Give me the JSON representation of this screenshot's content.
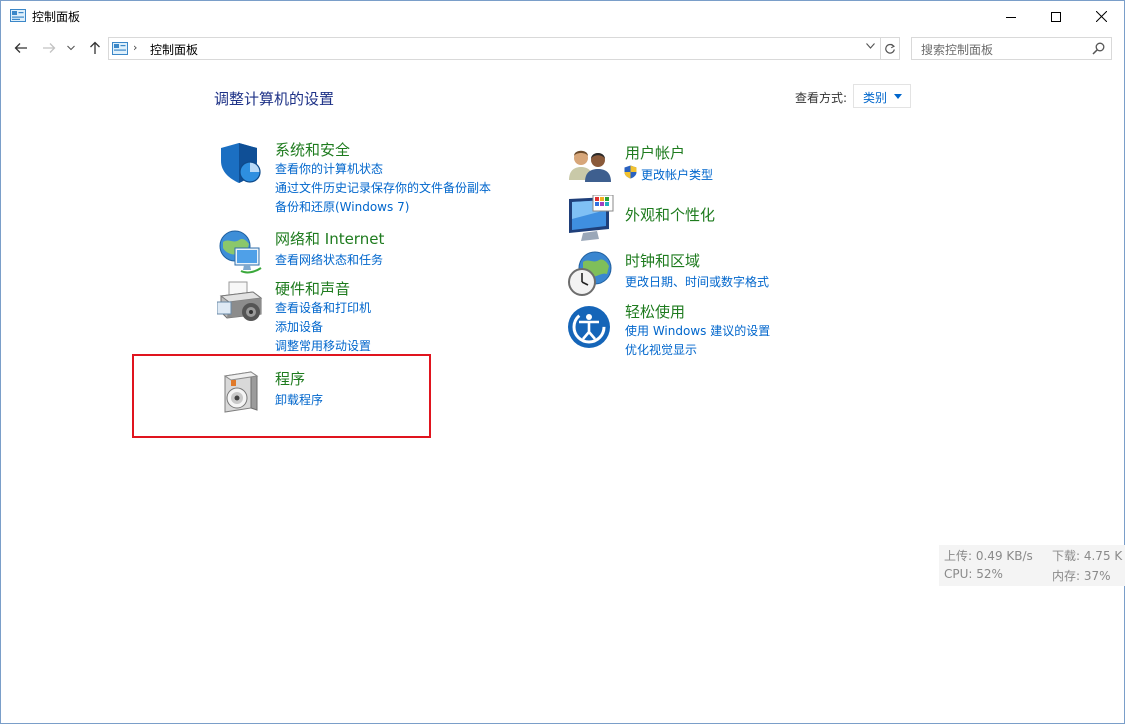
{
  "window": {
    "title": "控制面板",
    "icon": "control-panel-icon"
  },
  "nav": {
    "back_icon": "arrow-left-icon",
    "forward_icon": "arrow-right-icon",
    "recent_icon": "chevron-down-icon",
    "up_icon": "arrow-up-icon",
    "address_path": "控制面板",
    "search_placeholder": "搜索控制面板"
  },
  "main": {
    "heading": "调整计算机的设置",
    "view_by_label": "查看方式:",
    "view_by_value": "类别"
  },
  "categories": {
    "system_security": {
      "title": "系统和安全",
      "icon": "shield-icon",
      "links": [
        "查看你的计算机状态",
        "通过文件历史记录保存你的文件备份副本",
        "备份和还原(Windows 7)"
      ]
    },
    "network": {
      "title": "网络和 Internet",
      "icon": "network-globe-icon",
      "links": [
        "查看网络状态和任务"
      ]
    },
    "hardware": {
      "title": "硬件和声音",
      "icon": "printer-icon",
      "links": [
        "查看设备和打印机",
        "添加设备",
        "调整常用移动设置"
      ]
    },
    "programs": {
      "title": "程序",
      "icon": "programs-icon",
      "links": [
        "卸载程序"
      ]
    },
    "user_accounts": {
      "title": "用户帐户",
      "icon": "users-icon",
      "links": [
        "更改帐户类型"
      ]
    },
    "appearance": {
      "title": "外观和个性化",
      "icon": "monitor-icon",
      "links": []
    },
    "clock_region": {
      "title": "时钟和区域",
      "icon": "clock-globe-icon",
      "links": [
        "更改日期、时间或数字格式"
      ]
    },
    "ease_of_access": {
      "title": "轻松使用",
      "icon": "ease-of-access-icon",
      "links": [
        "使用 Windows 建议的设置",
        "优化视觉显示"
      ]
    }
  },
  "netmon": {
    "upload": "上传: 0.49 KB/s",
    "download": "下载: 4.75 K",
    "cpu": "CPU: 52%",
    "memory": "内存: 37%"
  },
  "colors": {
    "heading": "#1e3287",
    "category_title": "#1e7b1e",
    "link": "#0066cc",
    "highlight": "#e0141e"
  }
}
